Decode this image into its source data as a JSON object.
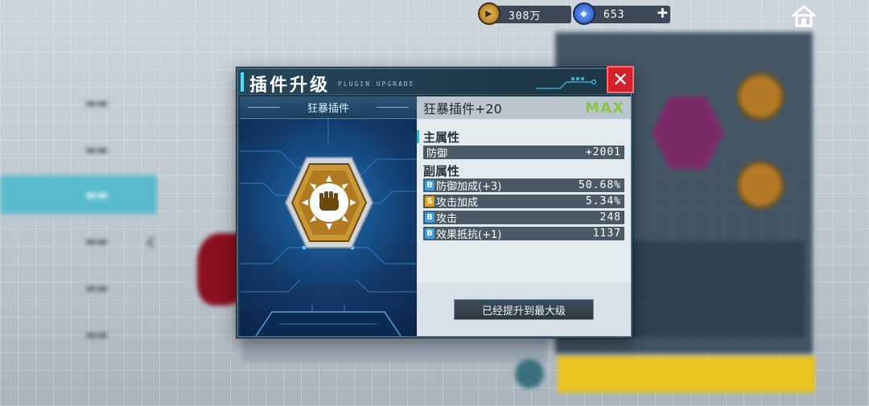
{
  "hud": {
    "gold_value": "308万",
    "gem_value": "653",
    "plus_label": "+"
  },
  "dialog": {
    "title": "插件升级",
    "subtitle": "PLUGIN UPGRADE",
    "close_label": "✕",
    "plugin_category": "狂暴插件",
    "plugin_name": "狂暴插件+20",
    "level_status": "MAX",
    "main_attr_title": "主属性",
    "main_attrs": [
      {
        "name": "防御",
        "value": "+2001"
      }
    ],
    "sub_attr_title": "副属性",
    "sub_attrs": [
      {
        "grade": "B",
        "name": "防御加成(+3)",
        "value": "50.68%"
      },
      {
        "grade": "S",
        "name": "攻击加成",
        "value": "5.34%"
      },
      {
        "grade": "B",
        "name": "攻击",
        "value": "248"
      },
      {
        "grade": "B",
        "name": "效果抵抗(+1)",
        "value": "1137"
      }
    ],
    "max_button_label": "已经提升到最大级"
  },
  "icons": {
    "gold": "coin-icon",
    "gem": "gem-icon",
    "home": "home-icon",
    "close": "close-icon",
    "plugin": "fist-plugin-icon"
  },
  "colors": {
    "accent": "#3fe0ff",
    "max_green": "#8ec63f",
    "close_red": "#d4202a",
    "grade_B": "#3aa0e0",
    "grade_S": "#e0a21f"
  }
}
